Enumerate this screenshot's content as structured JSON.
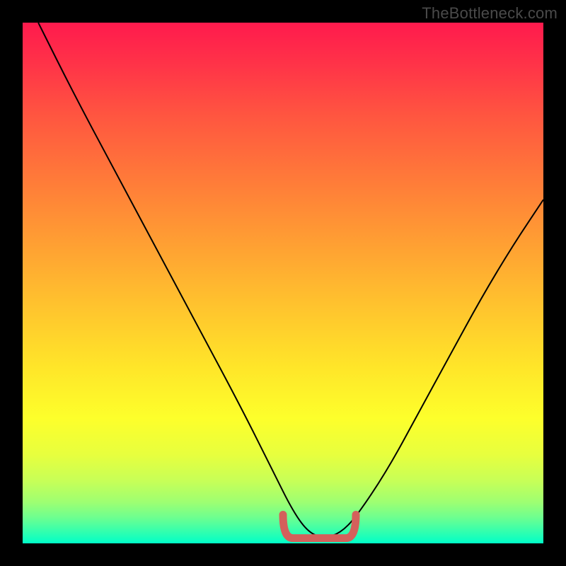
{
  "watermark": "TheBottleneck.com",
  "chart_data": {
    "type": "line",
    "title": "",
    "xlabel": "",
    "ylabel": "",
    "xlim": [
      0,
      100
    ],
    "ylim": [
      0,
      100
    ],
    "grid": false,
    "legend": false,
    "annotations": [],
    "series": [
      {
        "name": "bottleneck-curve",
        "x": [
          3,
          10,
          18,
          26,
          34,
          42,
          48,
          52,
          55,
          58,
          61,
          64,
          70,
          76,
          82,
          88,
          94,
          100
        ],
        "y": [
          100,
          86,
          71,
          56,
          41,
          26,
          14,
          6,
          2,
          1,
          2,
          5,
          14,
          25,
          36,
          47,
          57,
          66
        ]
      }
    ],
    "highlight_region": {
      "name": "optimal-zone",
      "x": [
        50,
        64
      ],
      "y": [
        2,
        2
      ]
    },
    "background_gradient": {
      "top": "#ff1a4d",
      "bottom": "#00ffc8"
    }
  }
}
